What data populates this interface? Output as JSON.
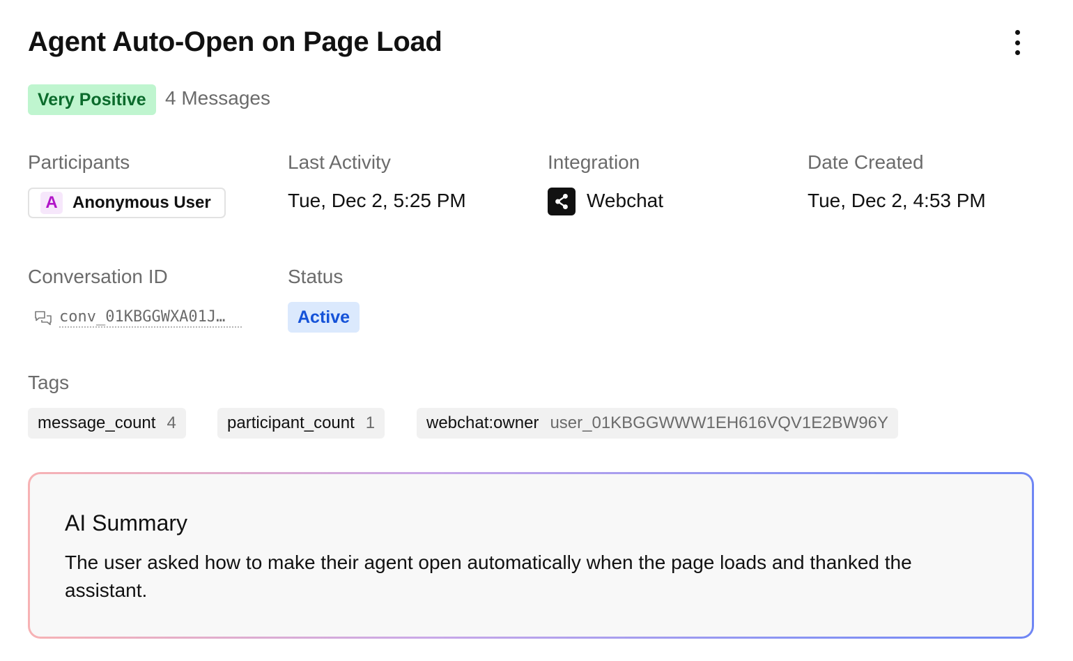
{
  "header": {
    "title": "Agent Auto-Open on Page Load",
    "menu_icon": "more-vertical-icon"
  },
  "meta": {
    "sentiment": "Very Positive",
    "message_count": "4 Messages"
  },
  "details": {
    "participants_label": "Participants",
    "participant_initial": "A",
    "participant_name": "Anonymous User",
    "last_activity_label": "Last Activity",
    "last_activity_value": "Tue, Dec 2, 5:25 PM",
    "integration_label": "Integration",
    "integration_icon": "share-nodes-icon",
    "integration_value": "Webchat",
    "date_created_label": "Date Created",
    "date_created_value": "Tue, Dec 2, 4:53 PM",
    "conversation_id_label": "Conversation ID",
    "conversation_id_icon": "chat-bubbles-icon",
    "conversation_id_value": "conv_01KBGGWXA01J…",
    "status_label": "Status",
    "status_value": "Active"
  },
  "tags": {
    "label": "Tags",
    "items": [
      {
        "key": "message_count",
        "value": "4"
      },
      {
        "key": "participant_count",
        "value": "1"
      },
      {
        "key": "webchat:owner",
        "value": "user_01KBGGWWW1EH616VQV1E2BW96Y"
      }
    ]
  },
  "summary": {
    "title": "AI Summary",
    "text": "The user asked how to make their agent open automatically when the page loads and thanked the assistant."
  },
  "colors": {
    "sentiment_bg": "#bff5cf",
    "sentiment_fg": "#0b6b2c",
    "status_bg": "#dbe9fd",
    "status_fg": "#1552d8",
    "avatar_bg": "#f6e7fb",
    "avatar_fg": "#b114c8"
  }
}
